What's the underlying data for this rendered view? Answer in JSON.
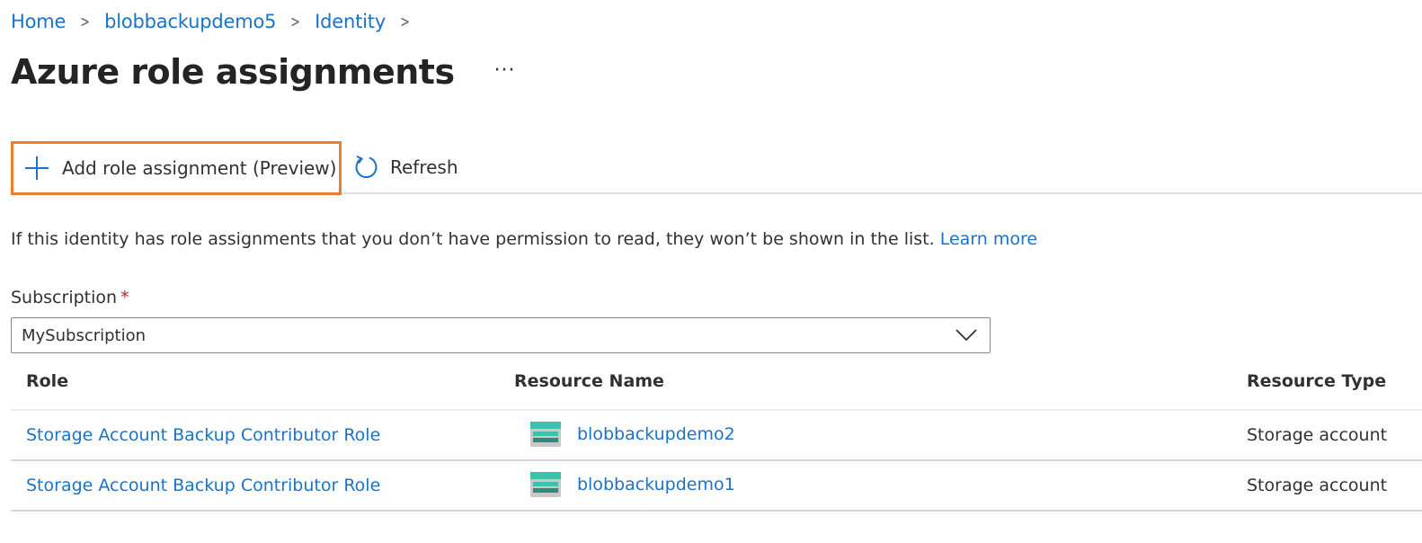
{
  "breadcrumb": [
    {
      "label": "Home"
    },
    {
      "label": "blobbackupdemo5"
    },
    {
      "label": "Identity"
    }
  ],
  "page": {
    "title": "Azure role assignments",
    "more_label": "···"
  },
  "toolbar": {
    "add_label": "Add role assignment (Preview)",
    "refresh_label": "Refresh",
    "highlight_color": "#ed7d31"
  },
  "info": {
    "text": "If this identity has role assignments that you don’t have permission to read, they won’t be shown in the list.",
    "link": "Learn more"
  },
  "subscription": {
    "label": "Subscription",
    "required_mark": "*",
    "value": "MySubscription"
  },
  "table": {
    "headers": [
      "Role",
      "Resource Name",
      "Resource Type"
    ],
    "rows": [
      {
        "role": "Storage Account Backup Contributor Role",
        "resource_name": "blobbackupdemo2",
        "resource_type": "Storage account",
        "icon": "storage-account-icon"
      },
      {
        "role": "Storage Account Backup Contributor Role",
        "resource_name": "blobbackupdemo1",
        "resource_type": "Storage account",
        "icon": "storage-account-icon"
      }
    ]
  },
  "colors": {
    "link": "#1a73c8",
    "accent_outline": "#ed7d31",
    "required": "#a4262c"
  }
}
